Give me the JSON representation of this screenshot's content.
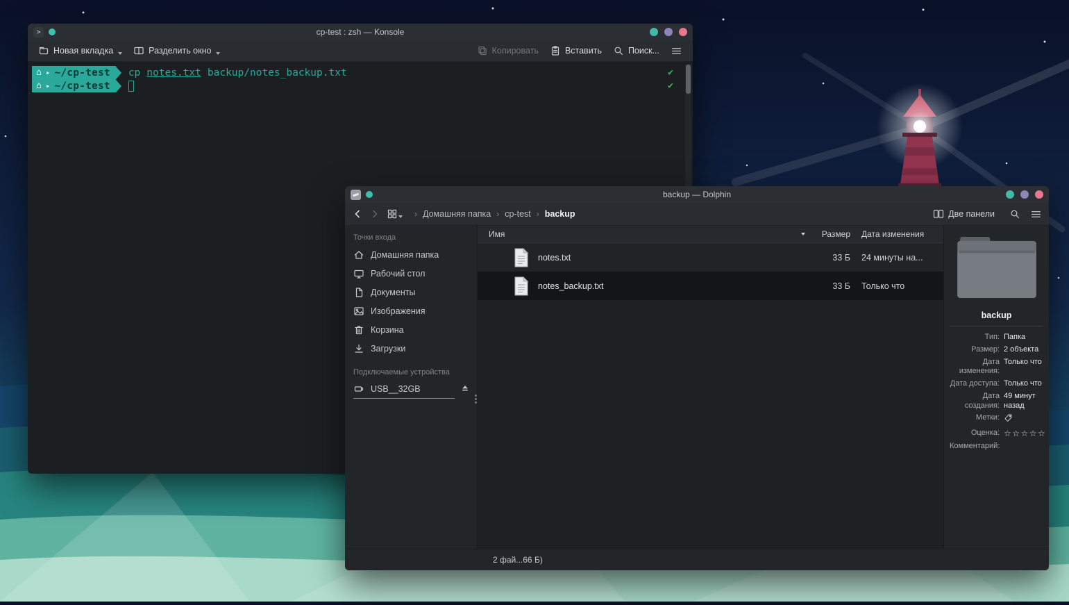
{
  "icons": {
    "check": "✔",
    "star": "☆☆☆☆☆",
    "house": "⌂",
    "prompt_arrow": "▸",
    "breadcrumb_sep": "›",
    "terminal_glyph": ">"
  },
  "konsole": {
    "title": "cp-test : zsh — Konsole",
    "toolbar": {
      "new_tab": "Новая вкладка",
      "split_window": "Разделить окно",
      "copy": "Копировать",
      "paste": "Вставить",
      "search": "Поиск..."
    },
    "terminal": {
      "prompt_path": "~/cp-test",
      "command": {
        "cmd": "cp",
        "arg1": "notes.txt",
        "arg2": "backup/notes_backup.txt"
      }
    }
  },
  "dolphin": {
    "title": "backup — Dolphin",
    "toolbar": {
      "two_panels": "Две панели"
    },
    "breadcrumb": {
      "items": [
        "Домашняя папка",
        "cp-test",
        "backup"
      ]
    },
    "sidebar": {
      "places_header": "Точки входа",
      "places": [
        "Домашняя папка",
        "Рабочий стол",
        "Документы",
        "Изображения",
        "Корзина",
        "Загрузки"
      ],
      "devices_header": "Подключаемые устройства",
      "device": "USB__32GB"
    },
    "list": {
      "col_name": "Имя",
      "col_size": "Размер",
      "col_date": "Дата изменения",
      "rows": [
        {
          "name": "notes.txt",
          "size": "33 Б",
          "date": "24 минуты на..."
        },
        {
          "name": "notes_backup.txt",
          "size": "33 Б",
          "date": "Только что"
        }
      ]
    },
    "info": {
      "title": "backup",
      "fields": [
        {
          "label": "Тип:",
          "value": "Папка"
        },
        {
          "label": "Размер:",
          "value": "2 объекта"
        },
        {
          "label": "Дата изменения:",
          "value": "Только что"
        },
        {
          "label": "Дата доступа:",
          "value": "Только что"
        },
        {
          "label": "Дата создания:",
          "value": "49 минут назад"
        },
        {
          "label": "Метки:",
          "value": ""
        },
        {
          "label": "Оценка:",
          "value": ""
        },
        {
          "label": "Комментарий:",
          "value": ""
        }
      ]
    },
    "status": "2 фай...66 Б)"
  }
}
